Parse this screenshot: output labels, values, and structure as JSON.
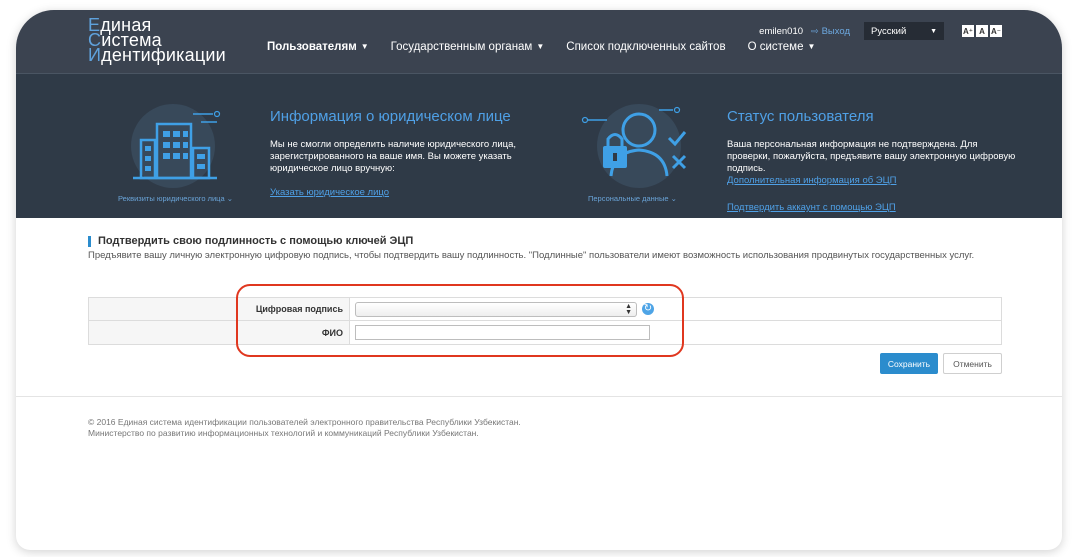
{
  "logo": {
    "line1": "Единая",
    "line2": "Система",
    "line3": "Идентификации"
  },
  "nav": [
    {
      "label": "Пользователям",
      "has_caret": true
    },
    {
      "label": "Государственным органам",
      "has_caret": true
    },
    {
      "label": "Список подключенных сайтов",
      "has_caret": false
    },
    {
      "label": "О системе",
      "has_caret": true
    }
  ],
  "user": {
    "name": "emilen010",
    "logout": "Выход",
    "language": "Русский"
  },
  "font_buttons": [
    "A⁺",
    "A",
    "A⁻"
  ],
  "info_left": {
    "caption": "Реквизиты юридического лица",
    "title": "Информация о юридическом лице",
    "text": "Мы не смогли определить наличие юридического лица, зарегистрированного на ваше имя. Вы можете указать юридическое лицо вручную:",
    "link": "Указать юридическое лицо"
  },
  "info_right": {
    "caption": "Персональные данные",
    "title": "Статус пользователя",
    "text": "Ваша персональная информация не подтверждена. Для проверки, пожалуйста, предъявите вашу электронную цифровую подпись.",
    "link1": "Дополнительная информация об ЭЦП",
    "link2": "Подтвердить аккаунт с помощью ЭЦП"
  },
  "section": {
    "title": "Подтвердить свою подлинность с помощью ключей ЭЦП",
    "description": "Предъявите вашу личную электронную цифровую подпись, чтобы подтвердить вашу подлинность. \"Подлинные\" пользователи имеют возможность использования продвинутых государственных услуг."
  },
  "form": {
    "signature_label": "Цифровая подпись",
    "signature_value": "",
    "fio_label": "ФИО",
    "fio_value": ""
  },
  "buttons": {
    "save": "Сохранить",
    "cancel": "Отменить"
  },
  "footer": {
    "line1": "© 2016 Единая система идентификации пользователей электронного правительства Республики Узбекистан.",
    "line2": "Министерство по развитию информационных технологий и коммуникаций Республики Узбекистан."
  },
  "colors": {
    "header_bg": "#3b4350",
    "band_bg": "#2f3a47",
    "accent": "#2b8ccd",
    "link": "#4fa0e6",
    "highlight": "#e0371f"
  }
}
